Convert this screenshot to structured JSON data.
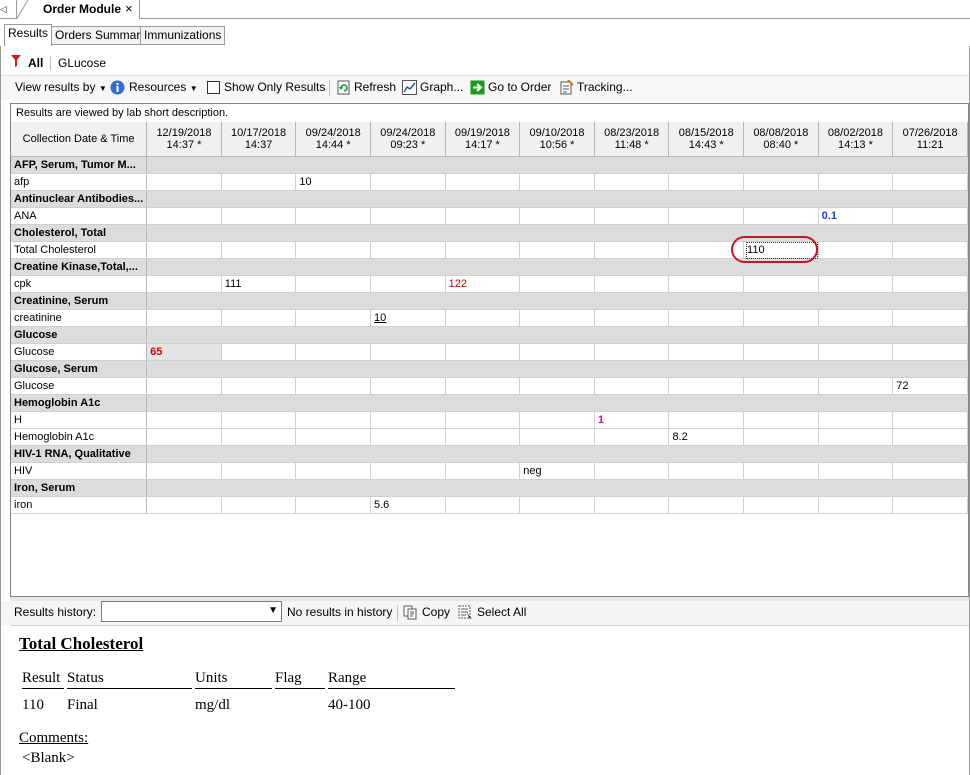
{
  "doc_tab": {
    "title": "Order Module",
    "close": "×"
  },
  "subtabs": [
    "Results",
    "Orders Summary",
    "Immunizations"
  ],
  "filter": {
    "all_label": "All",
    "text": "GLucose"
  },
  "toolbar": {
    "view_results_by": "View results by",
    "resources": "Resources",
    "show_only_results": "Show Only Results",
    "refresh": "Refresh",
    "graph": "Graph...",
    "go_to_order": "Go to Order",
    "tracking": "Tracking..."
  },
  "grid": {
    "caption": "Results are viewed by lab short description.",
    "corner_header": "Collection Date & Time",
    "columns": [
      {
        "date": "12/19/2018",
        "time": "14:37 *"
      },
      {
        "date": "10/17/2018",
        "time": "14:37"
      },
      {
        "date": "09/24/2018",
        "time": "14:44 *"
      },
      {
        "date": "09/24/2018",
        "time": "09:23 *"
      },
      {
        "date": "09/19/2018",
        "time": "14:17 *"
      },
      {
        "date": "09/10/2018",
        "time": "10:56 *"
      },
      {
        "date": "08/23/2018",
        "time": "11:48 *"
      },
      {
        "date": "08/15/2018",
        "time": "14:43 *"
      },
      {
        "date": "08/08/2018",
        "time": "08:40 *"
      },
      {
        "date": "08/02/2018",
        "time": "14:13 *"
      },
      {
        "date": "07/26/2018",
        "time": "11:21"
      }
    ],
    "rows": [
      {
        "type": "group",
        "label": "AFP, Serum, Tumor M..."
      },
      {
        "type": "test",
        "label": "afp",
        "values": {
          "2": {
            "v": "10"
          }
        }
      },
      {
        "type": "group",
        "label": "Antinuclear Antibodies..."
      },
      {
        "type": "test",
        "label": "ANA",
        "values": {
          "9": {
            "v": "0.1",
            "cls": "v-blue"
          }
        }
      },
      {
        "type": "group",
        "label": "Cholesterol, Total"
      },
      {
        "type": "test",
        "label": "Total Cholesterol",
        "values": {
          "8": {
            "v": "110"
          }
        }
      },
      {
        "type": "group",
        "label": "Creatine Kinase,Total,..."
      },
      {
        "type": "test",
        "label": "cpk",
        "values": {
          "1": {
            "v": "111"
          },
          "4": {
            "v": "122",
            "cls": "v-darkred"
          }
        }
      },
      {
        "type": "group",
        "label": "Creatinine, Serum"
      },
      {
        "type": "test",
        "label": "creatinine",
        "values": {
          "3": {
            "v": "10",
            "cls": "v-underline"
          }
        }
      },
      {
        "type": "group",
        "label": "Glucose"
      },
      {
        "type": "test",
        "label": "Glucose",
        "values": {
          "0": {
            "v": "65",
            "cls": "v-red v-grey-cell"
          }
        }
      },
      {
        "type": "group",
        "label": "Glucose, Serum"
      },
      {
        "type": "test",
        "label": "Glucose",
        "values": {
          "10": {
            "v": "72"
          }
        }
      },
      {
        "type": "group",
        "label": "Hemoglobin A1c"
      },
      {
        "type": "test",
        "label": "H",
        "values": {
          "6": {
            "v": "1",
            "cls": "v-magenta"
          }
        }
      },
      {
        "type": "test",
        "label": "Hemoglobin A1c",
        "values": {
          "7": {
            "v": "8.2"
          }
        }
      },
      {
        "type": "group",
        "label": "HIV-1 RNA, Qualitative"
      },
      {
        "type": "test",
        "label": "HIV",
        "values": {
          "5": {
            "v": "neg"
          }
        }
      },
      {
        "type": "group",
        "label": "Iron, Serum"
      },
      {
        "type": "test",
        "label": "iron",
        "values": {
          "3": {
            "v": "5.6"
          }
        }
      }
    ]
  },
  "history": {
    "label": "Results history:",
    "status": "No results in history",
    "copy": "Copy",
    "select_all": "Select All"
  },
  "detail": {
    "title": "Total Cholesterol",
    "headers": {
      "result": "Result",
      "status": "Status",
      "units": "Units",
      "flag": "Flag",
      "range": "Range"
    },
    "values": {
      "result": "110",
      "status": "Final",
      "units": "mg/dl",
      "flag": "",
      "range": "40-100"
    },
    "comments_label": "Comments:",
    "comments_value": "<Blank>"
  },
  "colors": {
    "alert_red": "#e00000",
    "high_darkred": "#c00000",
    "blue": "#1a3fd0",
    "magenta": "#e000e0",
    "highlight_oval": "#c0172a"
  }
}
